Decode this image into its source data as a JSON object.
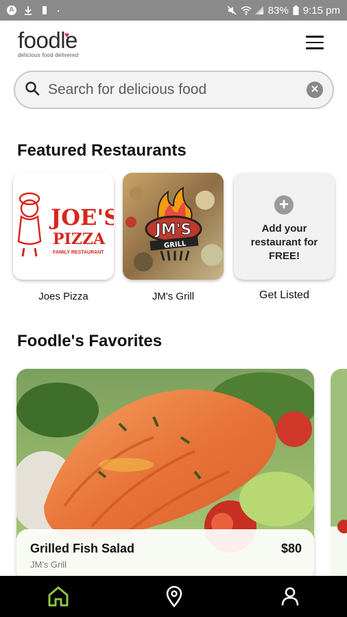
{
  "status_bar": {
    "battery": "83%",
    "time": "9:15 pm"
  },
  "header": {
    "logo_text": "foodle",
    "logo_tagline": "delicious food delivered"
  },
  "search": {
    "placeholder": "Search for delicious food"
  },
  "featured": {
    "title": "Featured Restaurants",
    "restaurants": [
      {
        "name": "Joes Pizza",
        "logo_top": "JOE'S",
        "logo_mid": "PIZZA",
        "logo_sub": "FAMILY RESTAURANT"
      },
      {
        "name": "JM's Grill",
        "logo_top": "JM'S",
        "logo_sub": "GRILL"
      }
    ],
    "add_card": {
      "line1": "Add your",
      "line2": "restaurant for",
      "line3": "FREE!",
      "label": "Get Listed"
    }
  },
  "favorites": {
    "title": "Foodle's Favorites",
    "items": [
      {
        "name": "Grilled Fish Salad",
        "restaurant": "JM's Grill",
        "price": "$80"
      }
    ]
  },
  "colors": {
    "accent": "#8dc63f",
    "status_bar": "#8a8a8a",
    "heart": "#e0245e",
    "joes_red": "#d8261c"
  },
  "bottom_nav": {
    "items": [
      "home-icon",
      "location-pin-icon",
      "profile-icon"
    ]
  }
}
